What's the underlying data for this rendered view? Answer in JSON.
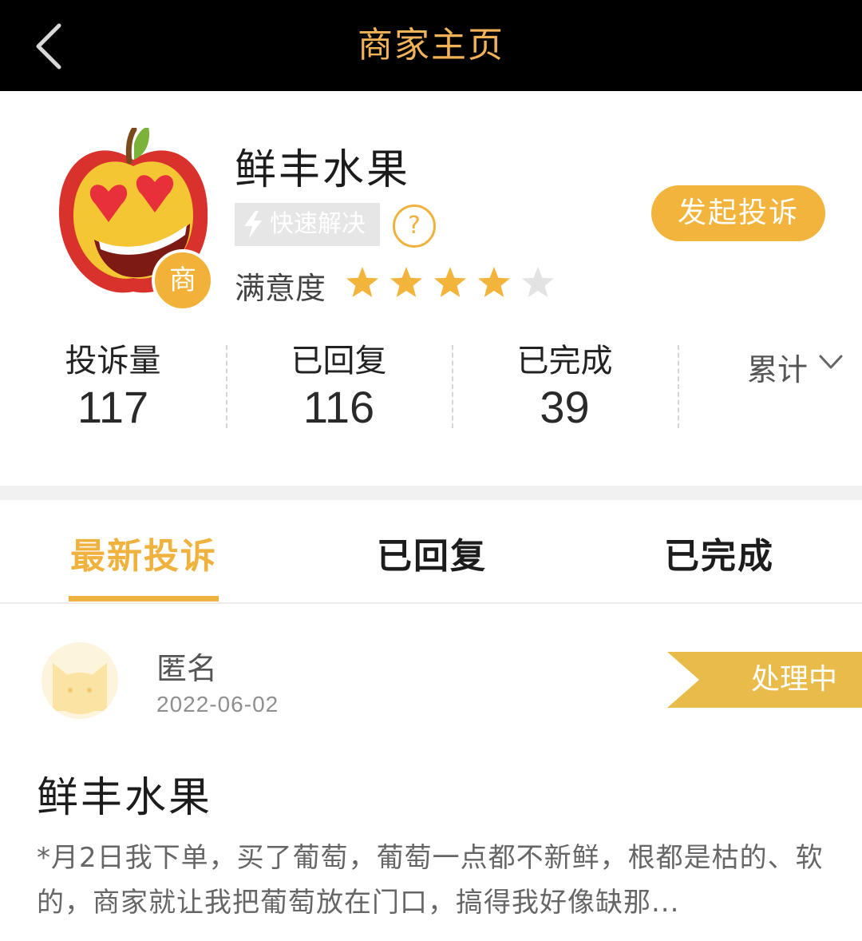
{
  "header_bar": {
    "title": "商家主页",
    "back_icon": "chevron-left-icon"
  },
  "merchant": {
    "name": "鲜丰水果",
    "avatar_icon": "apple-heart-eyes-icon",
    "badge": "商",
    "quick_resolve_label": "快速解决",
    "quick_resolve_icon": "lightning-icon",
    "help_icon_text": "?",
    "satisfaction_label": "满意度",
    "rating": 4,
    "rating_max": 5,
    "complain_button": "发起投诉"
  },
  "stats": [
    {
      "label": "投诉量",
      "value": "117"
    },
    {
      "label": "已回复",
      "value": "116"
    },
    {
      "label": "已完成",
      "value": "39"
    }
  ],
  "period_select": {
    "label": "累计",
    "icon": "chevron-down-icon"
  },
  "tabs": [
    {
      "label": "最新投诉",
      "active": true
    },
    {
      "label": "已回复",
      "active": false
    },
    {
      "label": "已完成",
      "active": false
    }
  ],
  "complaint": {
    "user": "匿名",
    "avatar_icon": "cat-avatar-icon",
    "date": "2022-06-02",
    "status": "处理中",
    "title": "鲜丰水果",
    "body": "*月2日我下单，买了葡萄，葡萄一点都不新鲜，根都是枯的、软的，商家就让我把葡萄放在门口，搞得我好像缺那..."
  },
  "colors": {
    "accent": "#f0b23f",
    "title_text": "#f2b257",
    "topbar_bg": "#000000",
    "star_filled": "#f3b43c",
    "star_empty": "#e3e3e3"
  }
}
